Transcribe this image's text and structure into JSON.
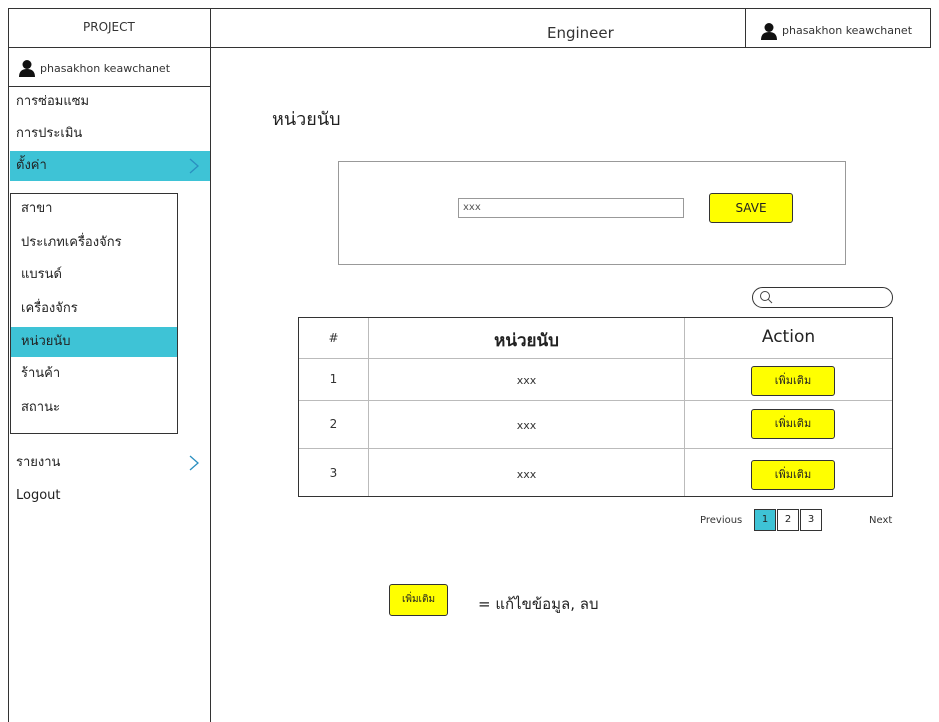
{
  "header": {
    "project_label": "PROJECT",
    "role_label": "Engineer",
    "user_name": "phasakhon keawchanet"
  },
  "sidebar": {
    "user_name": "phasakhon keawchanet",
    "items": [
      {
        "label": "การซ่อมแซม"
      },
      {
        "label": "การประเมิน"
      },
      {
        "label": "ตั้งค่า"
      },
      {
        "label": "รายงาน"
      },
      {
        "label": "Logout"
      }
    ],
    "submenu": [
      {
        "label": "สาขา"
      },
      {
        "label": "ประเภทเครื่องจักร"
      },
      {
        "label": "แบรนด์"
      },
      {
        "label": "เครื่องจักร"
      },
      {
        "label": "หน่วยนับ"
      },
      {
        "label": "ร้านค้า"
      },
      {
        "label": "สถานะ"
      }
    ]
  },
  "main": {
    "title": "หน่วยนับ",
    "input_value": "xxx",
    "save_label": "SAVE",
    "table": {
      "headers": [
        "#",
        "หน่วยนับ",
        "Action"
      ],
      "rows": [
        {
          "num": "1",
          "unit": "xxx",
          "action": "เพิ่มเติม"
        },
        {
          "num": "2",
          "unit": "xxx",
          "action": "เพิ่มเติม"
        },
        {
          "num": "3",
          "unit": "xxx",
          "action": "เพิ่มเติม"
        }
      ]
    },
    "pagination": {
      "previous": "Previous",
      "pages": [
        "1",
        "2",
        "3"
      ],
      "next": "Next"
    },
    "legend": {
      "button_label": "เพิ่มเติม",
      "text": "= แก้ไขข้อมูล, ลบ"
    }
  },
  "colors": {
    "accent": "#3ec3d6",
    "button": "#ffff00"
  },
  "icons": [
    "user-icon",
    "chevron-right-icon",
    "search-icon"
  ]
}
